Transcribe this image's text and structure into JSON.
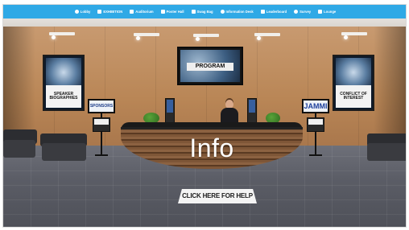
{
  "nav": {
    "items": [
      {
        "label": "Lobby",
        "icon": "home-icon"
      },
      {
        "label": "EXHIBITION",
        "icon": "exhibit-icon"
      },
      {
        "label": "Auditorium",
        "icon": "auditorium-icon"
      },
      {
        "label": "Poster Hall",
        "icon": "poster-icon"
      },
      {
        "label": "Swag Bag",
        "icon": "bag-icon"
      },
      {
        "label": "Information Desk",
        "icon": "info-icon"
      },
      {
        "label": "Leaderboard",
        "icon": "leaderboard-icon"
      },
      {
        "label": "Survey",
        "icon": "survey-icon"
      },
      {
        "label": "Lounge",
        "icon": "lounge-icon"
      }
    ],
    "color": "#2fa9e6"
  },
  "room": {
    "left_poster": "SPEAKER BIOGRAPHIES",
    "center_screen": "PROGRAM",
    "right_poster": "CONFLICT OF INTEREST",
    "left_sign": "SPONSORS",
    "right_sign": "JAMMI",
    "desk_label": "Info"
  },
  "help_button": {
    "label": "CLICK HERE FOR HELP"
  }
}
